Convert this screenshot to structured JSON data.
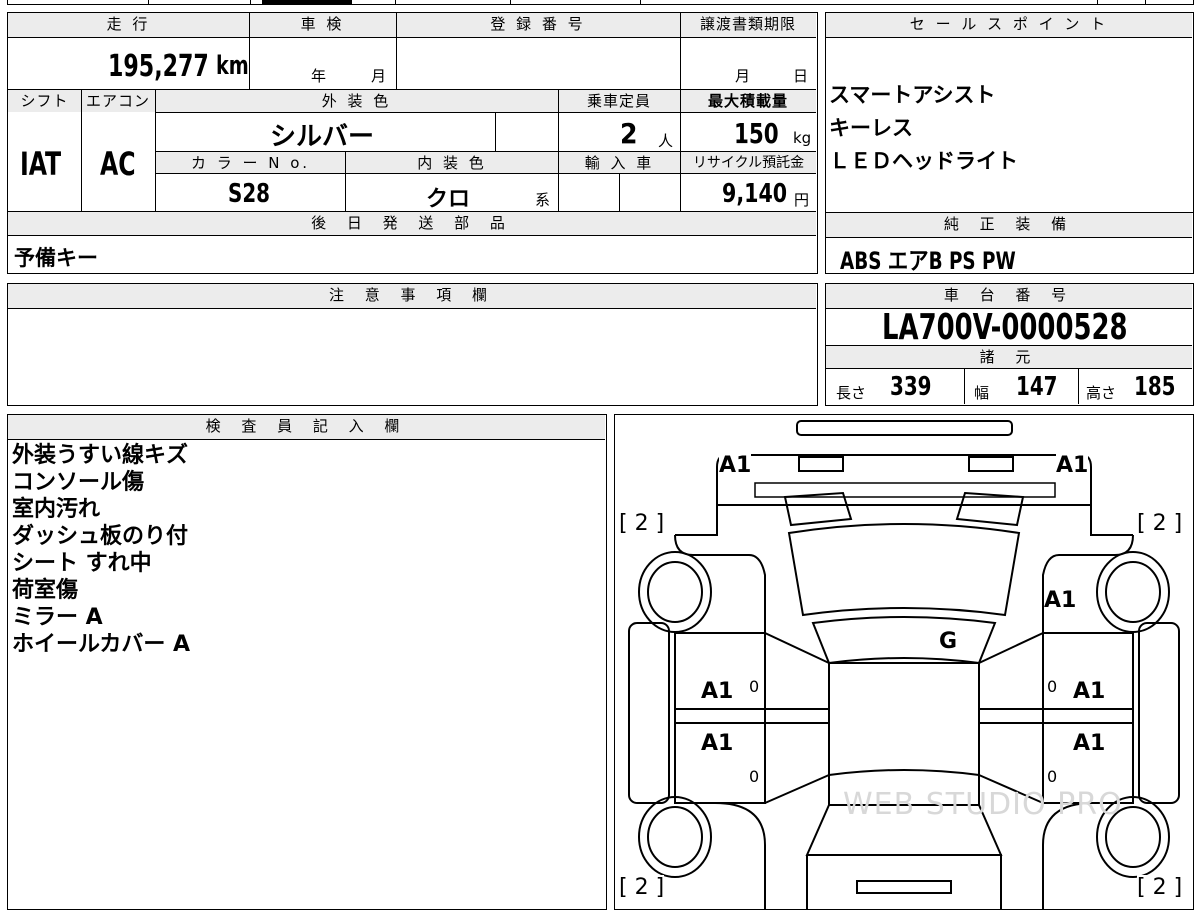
{
  "top_row": {
    "mileage_header": "走 行",
    "inspection_header": "車 検",
    "registration_header": "登 録 番 号",
    "transfer_header": "譲渡書類期限",
    "mileage_value": "195,277",
    "mileage_unit": "km",
    "inspection_year": "年",
    "inspection_month": "月",
    "transfer_month": "月",
    "transfer_day": "日"
  },
  "spec_row": {
    "shift_header": "シフト",
    "ac_header": "エアコン",
    "exterior_color_header": "外 装 色",
    "capacity_header": "乗車定員",
    "max_load_header": "最大積載量",
    "shift_value": "IAT",
    "ac_value": "AC",
    "exterior_color_value": "シルバー",
    "capacity_value": "2",
    "capacity_unit": "人",
    "max_load_value": "150",
    "max_load_unit": "kg",
    "color_no_header": "カ ラ ー N o.",
    "interior_color_header": "内 装 色",
    "import_header": "輸 入 車",
    "recycle_header": "リサイクル預託金",
    "color_no_value": "S28",
    "interior_color_value": "クロ",
    "interior_color_suffix": "系",
    "recycle_value": "9,140",
    "recycle_unit": "円"
  },
  "later_parts": {
    "header": "後 日 発 送 部 品",
    "value": "予備キー"
  },
  "sales_points": {
    "header": "セ ー ル ス ポ イ ン ト",
    "items": [
      "スマートアシスト",
      "キーレス",
      "ＬＥＤヘッドライト"
    ]
  },
  "standard_equipment": {
    "header": "純 正 装 備",
    "value": "ABS エアB PS PW"
  },
  "notes": {
    "header": "注 意 事 項 欄"
  },
  "chassis": {
    "header": "車 台 番 号",
    "value": "LA700V-0000528",
    "dimensions_header": "諸 元",
    "length_label": "長さ",
    "length_value": "339",
    "width_label": "幅",
    "width_value": "147",
    "height_label": "高さ",
    "height_value": "185"
  },
  "inspector": {
    "header": "検 査 員 記 入 欄",
    "items": [
      "外装うすい線キズ",
      "コンソール傷",
      "室内汚れ",
      "ダッシュ板のり付",
      "シート すれ中",
      "荷室傷",
      "ミラー A",
      "ホイールカバー A"
    ]
  },
  "diagram": {
    "marks": {
      "front_left": "A1",
      "front_right": "A1",
      "tire_fl": "[ 2 ]",
      "tire_fr": "[ 2 ]",
      "right_fender": "A1",
      "windshield": "G",
      "left_front_door": "A1",
      "left_front_door_zero": "0",
      "right_front_door": "A1",
      "right_front_door_zero": "0",
      "left_rear_door": "A1",
      "left_rear_door_zero": "0",
      "right_rear_door": "A1",
      "right_rear_door_zero": "0",
      "tire_rl": "[ 2 ]",
      "tire_rr": "[ 2 ]"
    },
    "watermark": "WEB STUDIO PRO"
  }
}
